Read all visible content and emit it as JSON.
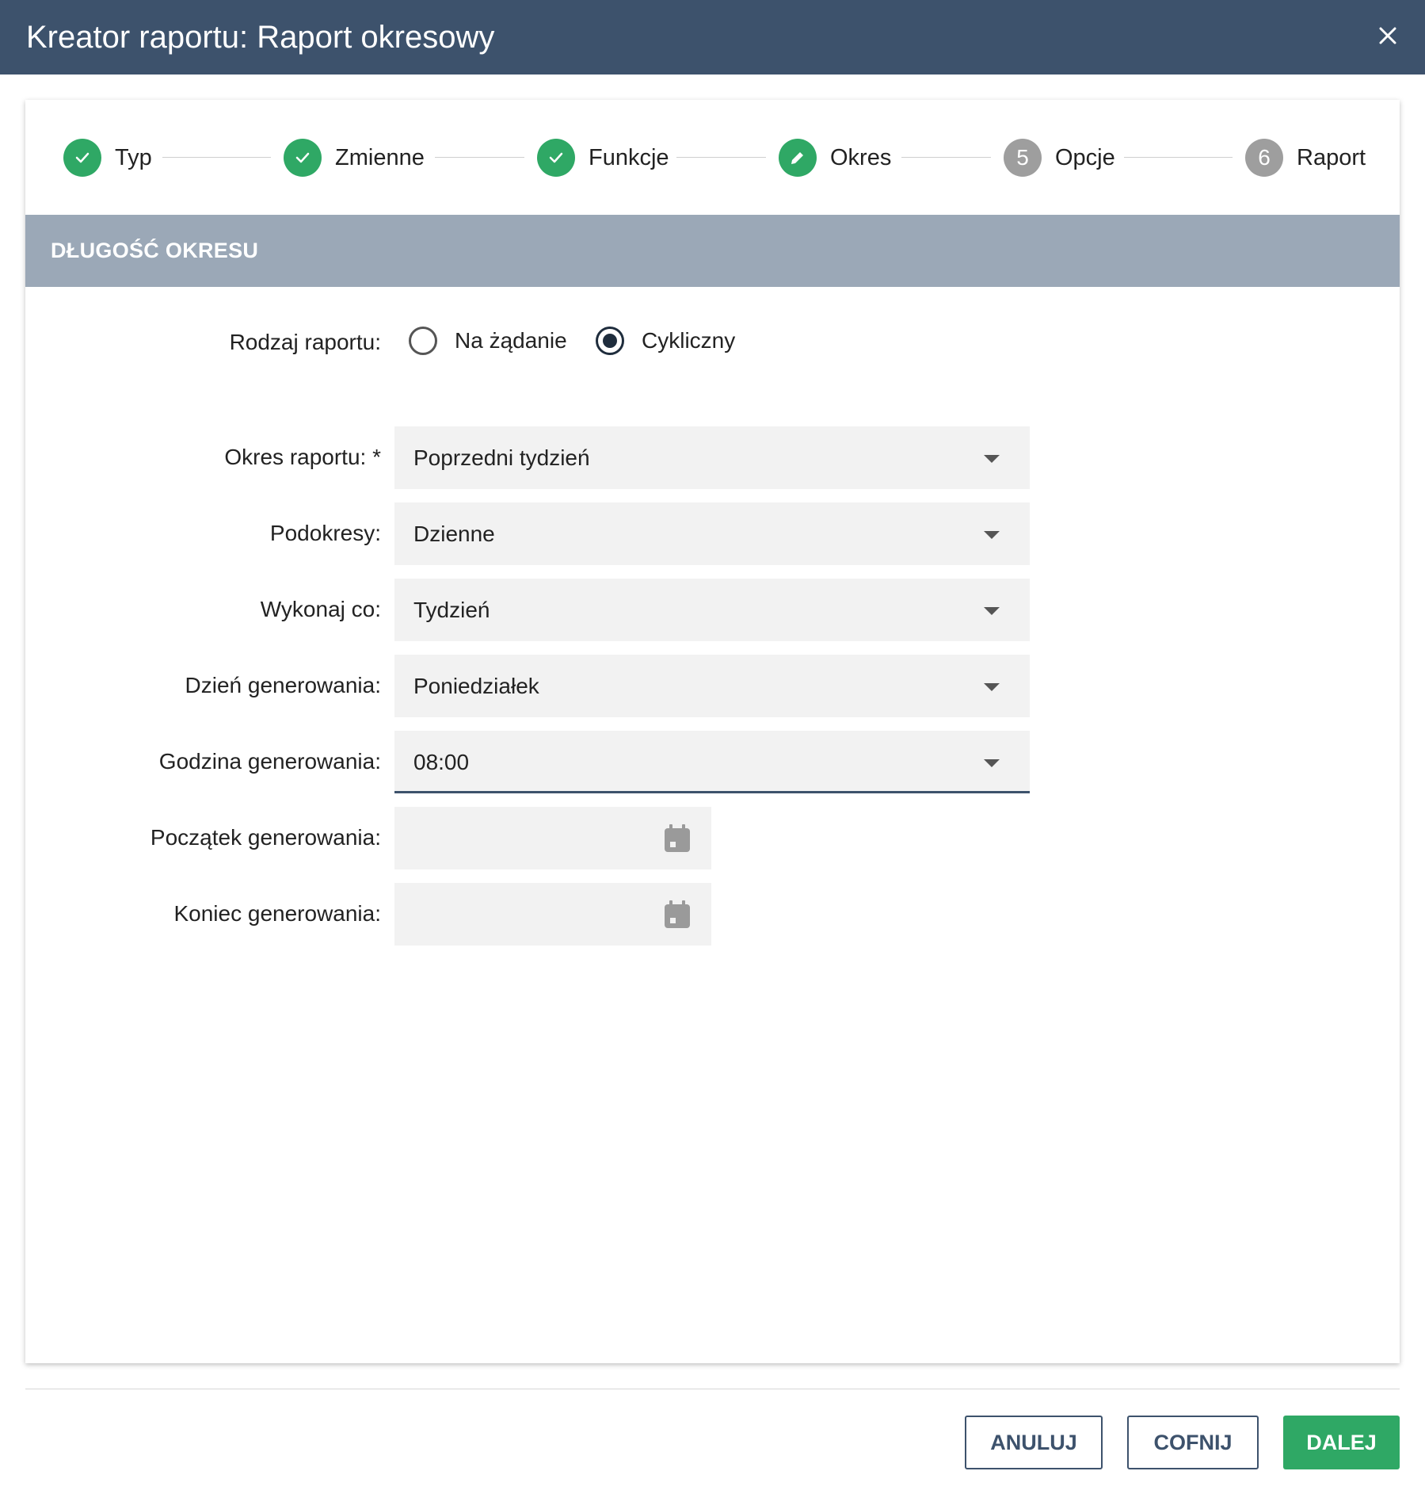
{
  "window": {
    "title": "Kreator raportu: Raport okresowy"
  },
  "stepper": {
    "steps": [
      {
        "label": "Typ",
        "state": "done",
        "number": ""
      },
      {
        "label": "Zmienne",
        "state": "done",
        "number": ""
      },
      {
        "label": "Funkcje",
        "state": "done",
        "number": ""
      },
      {
        "label": "Okres",
        "state": "active",
        "number": ""
      },
      {
        "label": "Opcje",
        "state": "todo",
        "number": "5"
      },
      {
        "label": "Raport",
        "state": "todo",
        "number": "6"
      }
    ]
  },
  "section": {
    "title": "DŁUGOŚĆ OKRESU"
  },
  "form": {
    "report_type": {
      "label": "Rodzaj raportu:",
      "options": [
        "Na żądanie",
        "Cykliczny"
      ],
      "selected": "Cykliczny"
    },
    "period": {
      "label": "Okres raportu: *",
      "value": "Poprzedni tydzień"
    },
    "subperiods": {
      "label": "Podokresy:",
      "value": "Dzienne"
    },
    "run_every": {
      "label": "Wykonaj co:",
      "value": "Tydzień"
    },
    "gen_day": {
      "label": "Dzień generowania:",
      "value": "Poniedziałek"
    },
    "gen_hour": {
      "label": "Godzina generowania:",
      "value": "08:00"
    },
    "gen_start": {
      "label": "Początek generowania:",
      "value": ""
    },
    "gen_end": {
      "label": "Koniec generowania:",
      "value": ""
    }
  },
  "buttons": {
    "cancel": "ANULUJ",
    "back": "COFNIJ",
    "next": "DALEJ"
  },
  "colors": {
    "header": "#3d526c",
    "section": "#9ba8b7",
    "success": "#2fa865",
    "pending": "#9e9e9e"
  },
  "icons": {
    "close": "close-icon",
    "done": "check-icon",
    "active": "pencil-icon",
    "date": "calendar-icon",
    "select": "dropdown-arrow-icon"
  }
}
